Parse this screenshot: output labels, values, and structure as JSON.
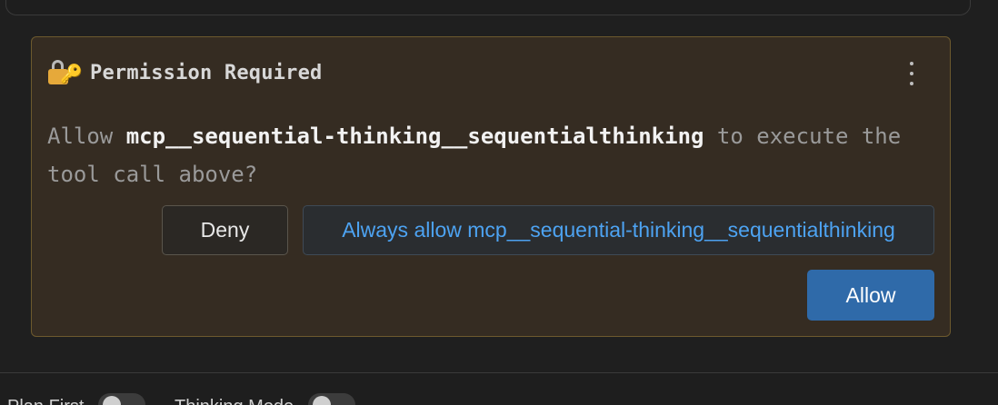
{
  "permission": {
    "title": "Permission Required",
    "message_prefix": "Allow ",
    "tool_name": "mcp__sequential-thinking__sequentialthinking",
    "message_suffix": " to execute the tool call above?",
    "deny_label": "Deny",
    "always_allow_label": "Always allow mcp__sequential-thinking__sequentialthinking",
    "allow_label": "Allow"
  },
  "footer": {
    "plan_first_label": "Plan First",
    "thinking_mode_label": "Thinking Mode"
  },
  "colors": {
    "card_background": "#352c22",
    "card_border": "#6d5a2e",
    "allow_button": "#2f6aa9",
    "always_allow_text": "#4da3f2"
  },
  "icons": {
    "header": "lock-with-key-icon",
    "menu": "kebab-menu-icon"
  }
}
